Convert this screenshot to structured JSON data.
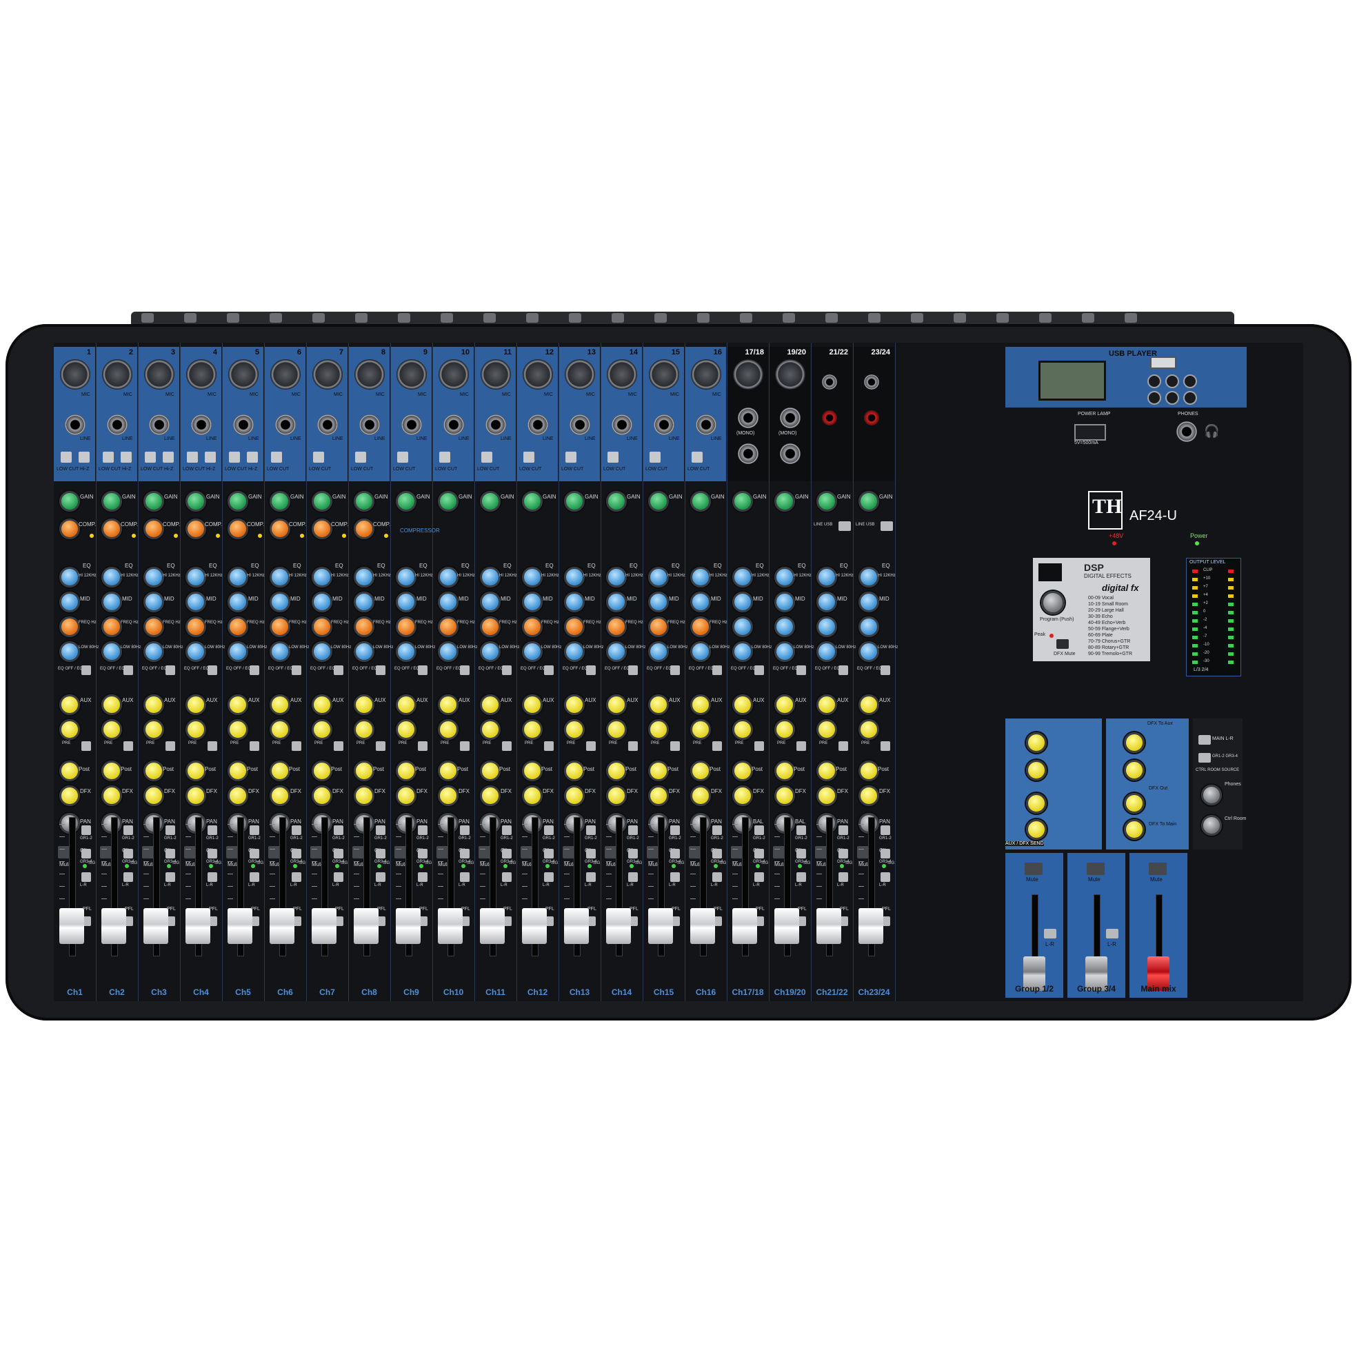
{
  "brand": {
    "logo_text": "TH",
    "model": "AF24-U"
  },
  "channels": [
    {
      "top_label": "1",
      "name": "Ch1",
      "stereo": false
    },
    {
      "top_label": "2",
      "name": "Ch2",
      "stereo": false
    },
    {
      "top_label": "3",
      "name": "Ch3",
      "stereo": false
    },
    {
      "top_label": "4",
      "name": "Ch4",
      "stereo": false
    },
    {
      "top_label": "5",
      "name": "Ch5",
      "stereo": false
    },
    {
      "top_label": "6",
      "name": "Ch6",
      "stereo": false
    },
    {
      "top_label": "7",
      "name": "Ch7",
      "stereo": false
    },
    {
      "top_label": "8",
      "name": "Ch8",
      "stereo": false
    },
    {
      "top_label": "9",
      "name": "Ch9",
      "stereo": false
    },
    {
      "top_label": "10",
      "name": "Ch10",
      "stereo": false
    },
    {
      "top_label": "11",
      "name": "Ch11",
      "stereo": false
    },
    {
      "top_label": "12",
      "name": "Ch12",
      "stereo": false
    },
    {
      "top_label": "13",
      "name": "Ch13",
      "stereo": false
    },
    {
      "top_label": "14",
      "name": "Ch14",
      "stereo": false
    },
    {
      "top_label": "15",
      "name": "Ch15",
      "stereo": false
    },
    {
      "top_label": "16",
      "name": "Ch16",
      "stereo": false
    },
    {
      "top_label": "17/18",
      "name": "Ch17/18",
      "stereo": true
    },
    {
      "top_label": "19/20",
      "name": "Ch19/20",
      "stereo": true
    },
    {
      "top_label": "21/22",
      "name": "Ch21/22",
      "stereo": true
    },
    {
      "top_label": "23/24",
      "name": "Ch23/24",
      "stereo": true
    }
  ],
  "strip_labels": {
    "mic": "MIC",
    "line": "LINE",
    "low_cut": "LOW CUT",
    "hi_z": "Hi-Z",
    "gain": "GAIN",
    "comp": "COMP.",
    "eq": "EQ",
    "hi": "HI 12KHz",
    "mid": "MID",
    "freq": "FREQ Hz",
    "low": "LOW 80Hz",
    "eq_switch": "EQ OFF / EQ ON",
    "aux": "AUX",
    "pre": "PRE",
    "post": "Post",
    "dfx": "DFX",
    "pan": "PAN",
    "bal": "BAL",
    "mute": "Mute",
    "clip": "Clip",
    "sig": "SIG",
    "pfl": "PFL",
    "gr12": "GR1-2",
    "gr34": "GR3-4",
    "lr": "L-R",
    "mono": "(MONO)",
    "line_usb": "LINE USB"
  },
  "master": {
    "usb_player": "USB PLAYER",
    "power_lamp": "POWER LAMP",
    "power_spec": "5V=500mA",
    "phones": "PHONES",
    "phantom": "+48V",
    "power": "Power",
    "compressor": "COMPRESSOR",
    "dsp_title": "DSP",
    "dsp_sub": "DIGITAL EFFECTS",
    "dsp_brand": "digital fx",
    "program": "Program (Push)",
    "peak": "Peak",
    "dfx_mute": "DFX Mute",
    "output_level": "OUTPUT LEVEL",
    "aux_dfx_send": "AUX / DFX SEND",
    "dfx_to_aux": "DFX To Aux",
    "dfx_out": "DFX Out",
    "dfx_to_main": "DFX To Main",
    "ctrl_room_source": "CTRL ROOM SOURCE",
    "phones_knob": "Phones",
    "ctrl_room": "Ctrl Room",
    "main_lr": "MAIN L-R",
    "gr12_gr34": "GR1-2 GR3-4",
    "group12": "Group 1/2",
    "group34": "Group 3/4",
    "main_mix": "Main mix",
    "mute": "Mute",
    "lr": "L-R",
    "effect_list": [
      "00-09 Vocal",
      "10-19 Small Room",
      "20-29 Large Hall",
      "30-39 Echo",
      "40-49 Echo+Verb",
      "50-59 Flange+Verb",
      "60-69 Plate",
      "70-79 Chorus+GTR",
      "80-89 Rotary+GTR",
      "90-99 Tremolo+GTR"
    ],
    "meter_labels": [
      "CLIP",
      "+10",
      "+7",
      "+4",
      "+2",
      "0",
      "-2",
      "-4",
      "-7",
      "-10",
      "-20",
      "-30"
    ],
    "meter_sides": "L/3 2/4"
  },
  "colors": {
    "panel_blue": "#2f5f9c",
    "gain_knob": "#1f9b4d",
    "comp_knob": "#e36c10",
    "eq_knob": "#3b8fd2",
    "aux_knob": "#e4d21c",
    "main_fader": "#d8141f"
  }
}
